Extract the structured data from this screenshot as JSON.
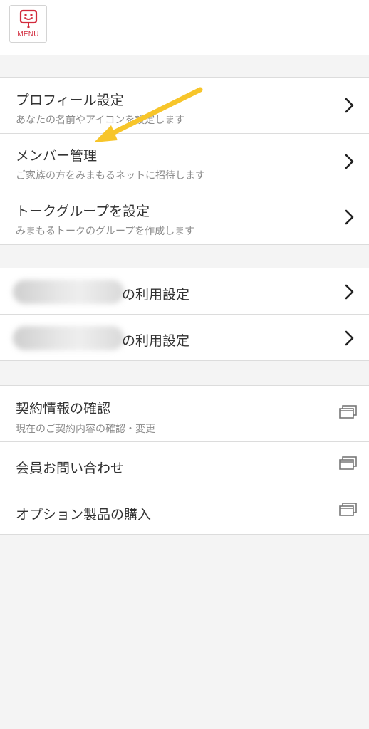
{
  "header": {
    "menu_label": "MENU"
  },
  "groups": [
    {
      "items": [
        {
          "title": "プロフィール設定",
          "subtitle": "あなたの名前やアイコンを設定します",
          "action": "chevron-right-icon"
        },
        {
          "title": "メンバー管理",
          "subtitle": "ご家族の方をみまもるネットに招待します",
          "action": "chevron-right-icon"
        },
        {
          "title": "トークグループを設定",
          "subtitle": "みまもるトークのグループを作成します",
          "action": "chevron-right-icon"
        }
      ]
    },
    {
      "items": [
        {
          "title": "の利用設定",
          "action": "chevron-right-icon",
          "redacted_prefix": true
        },
        {
          "title": "の利用設定",
          "action": "chevron-right-icon",
          "redacted_prefix": true
        }
      ]
    },
    {
      "items": [
        {
          "title": "契約情報の確認",
          "subtitle": "現在のご契約内容の確認・変更",
          "action": "external-window-icon"
        },
        {
          "title": "会員お問い合わせ",
          "action": "external-window-icon"
        },
        {
          "title": "オプション製品の購入",
          "action": "external-window-icon"
        }
      ]
    }
  ],
  "colors": {
    "brand_red": "#d22a3c",
    "annotation_arrow": "#f7c52a",
    "background": "#f4f4f4"
  }
}
